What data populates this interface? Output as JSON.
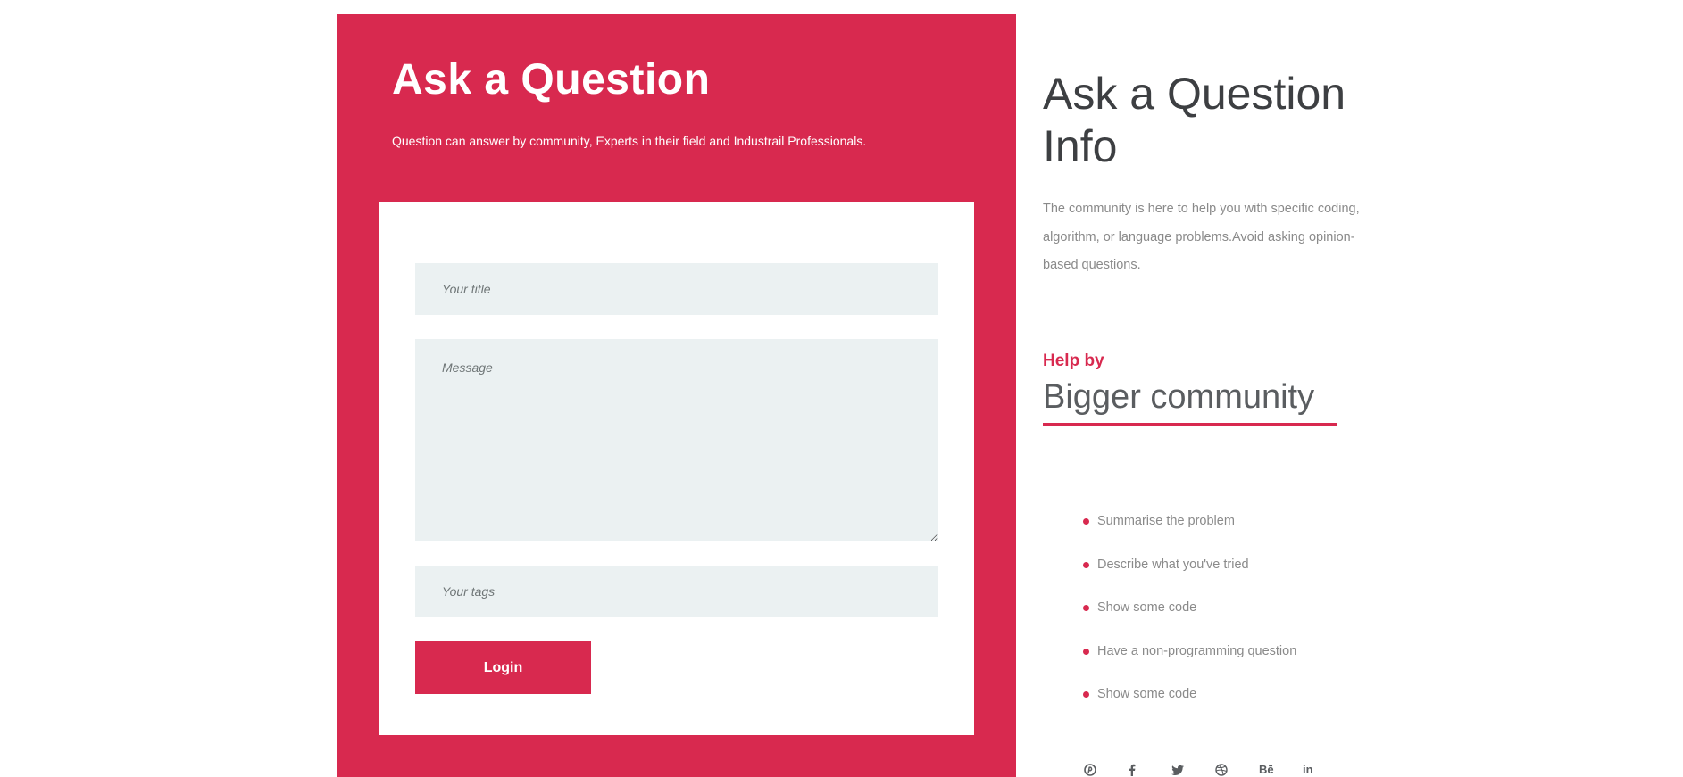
{
  "form": {
    "title": "Ask a Question",
    "subtitle": "Question can answer by community, Experts in their field and Industrail Professionals.",
    "title_placeholder": "Your title",
    "message_placeholder": "Message",
    "tags_placeholder": "Your tags",
    "submit_label": "Login",
    "accent_color": "#d8294f",
    "field_background": "#ebf1f2"
  },
  "info": {
    "title": "Ask a Question Info",
    "description": "The community is here to help you with specific coding, algorithm, or language problems.Avoid asking opinion-based questions.",
    "help_label": "Help by",
    "help_title": "Bigger community",
    "tips": [
      "Summarise the problem",
      "Describe what you've tried",
      "Show some code",
      "Have a non-programming question",
      "Show some code"
    ]
  },
  "social": [
    {
      "icon": "pinterest-icon"
    },
    {
      "icon": "facebook-icon"
    },
    {
      "icon": "twitter-icon"
    },
    {
      "icon": "dribbble-icon"
    },
    {
      "icon": "behance-icon",
      "text": "Bē"
    },
    {
      "icon": "linkedin-icon",
      "text": "in"
    }
  ]
}
